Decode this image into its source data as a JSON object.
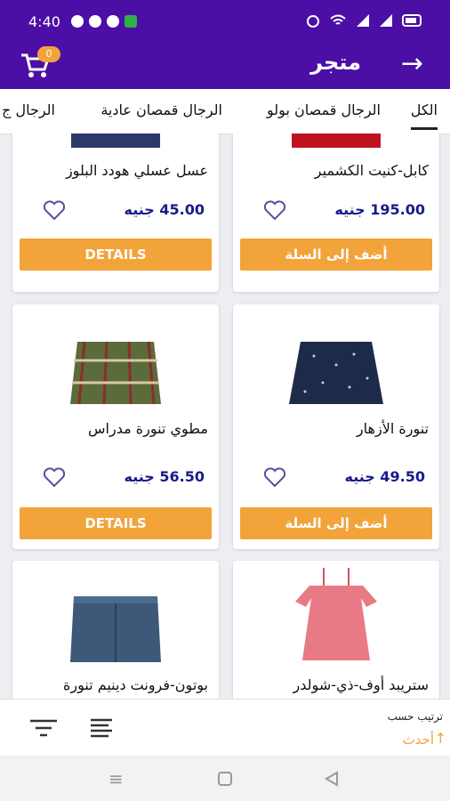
{
  "status": {
    "time": "4:40"
  },
  "appbar": {
    "title": "متجر",
    "cart_count": "0"
  },
  "tabs": [
    {
      "label": "الكل"
    },
    {
      "label": "الرجال قمصان بولو"
    },
    {
      "label": "الرجال قمصان عادية"
    },
    {
      "label": "الرجال ج"
    }
  ],
  "products": [
    {
      "name": "كابل-كنيت الكشمير",
      "price": "195.00 جنيه",
      "button": "أضف إلى السلة"
    },
    {
      "name": "عسل عسلي هودد البلوز",
      "price": "45.00 جنيه",
      "button": "DETAILS"
    },
    {
      "name": "تنورة الأزهار",
      "price": "49.50 جنيه",
      "button": "أضف إلى السلة"
    },
    {
      "name": "مطوي تنورة مدراس",
      "price": "56.50 جنيه",
      "button": "DETAILS"
    },
    {
      "name": "ستريبد أوف-ذي-شولدر",
      "price": "",
      "button": ""
    },
    {
      "name": "بوتون-فرونت دينيم تنورة",
      "price": "",
      "button": ""
    }
  ],
  "bottom": {
    "sort_label": "ترتيب حسب",
    "sort_value": "أحدث"
  },
  "colors": {
    "primary": "#4b0fa6",
    "accent": "#f2a33a",
    "price": "#1a1a8c"
  }
}
